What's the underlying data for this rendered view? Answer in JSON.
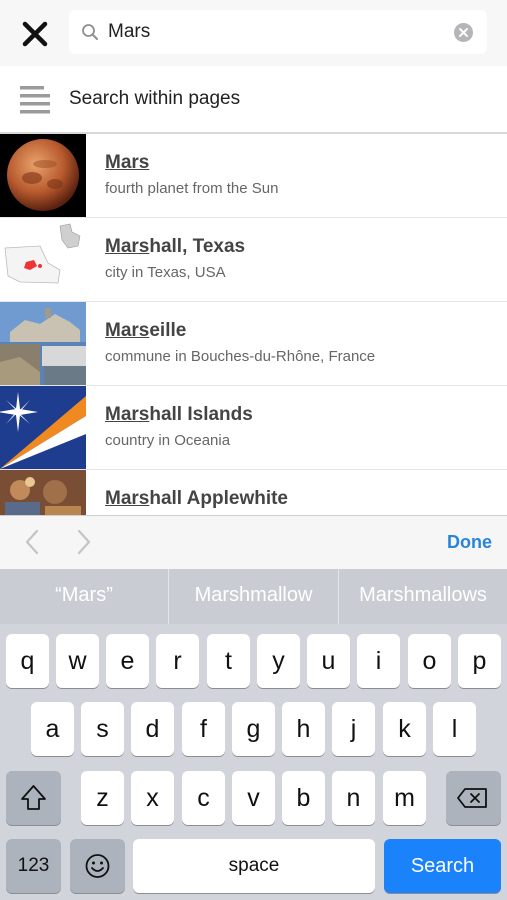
{
  "search": {
    "query": "Mars",
    "within_label": "Search within pages"
  },
  "results": [
    {
      "title_match": "Mars",
      "title_rest": "",
      "description": "fourth planet from the Sun"
    },
    {
      "title_match": "Mars",
      "title_rest": "hall, Texas",
      "description": "city in Texas, USA"
    },
    {
      "title_match": "Mars",
      "title_rest": "eille",
      "description": "commune in Bouches-du-Rhône, France"
    },
    {
      "title_match": "Mars",
      "title_rest": "hall Islands",
      "description": "country in Oceania"
    },
    {
      "title_match": "Mars",
      "title_rest": "hall Applewhite",
      "description": ""
    }
  ],
  "accessory": {
    "done_label": "Done"
  },
  "predictions": [
    "“Mars”",
    "Marshmallow",
    "Marshmallows"
  ],
  "keyboard": {
    "row1": [
      "q",
      "w",
      "e",
      "r",
      "t",
      "y",
      "u",
      "i",
      "o",
      "p"
    ],
    "row2": [
      "a",
      "s",
      "d",
      "f",
      "g",
      "h",
      "j",
      "k",
      "l"
    ],
    "row3": [
      "z",
      "x",
      "c",
      "v",
      "b",
      "n",
      "m"
    ],
    "numbers_label": "123",
    "space_label": "space",
    "search_label": "Search"
  },
  "colors": {
    "accent": "#2a84d8",
    "search_key": "#1a82fb",
    "keyboard_bg": "#d1d5db"
  }
}
